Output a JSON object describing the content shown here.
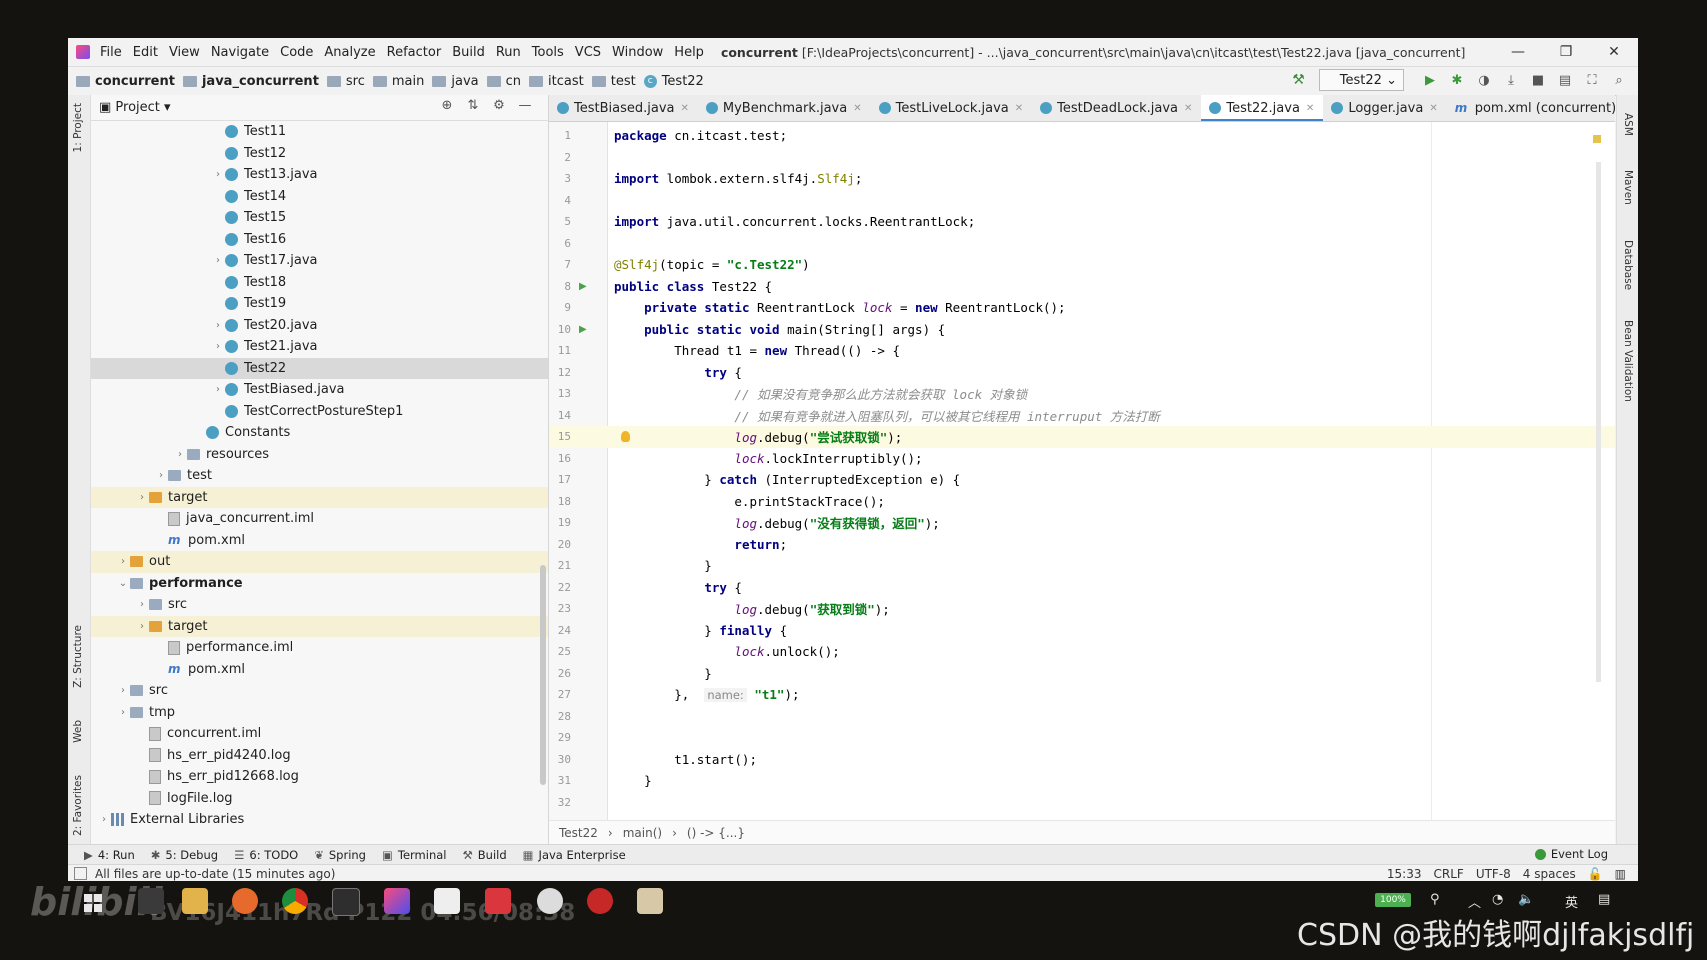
{
  "menu": {
    "items": [
      "File",
      "Edit",
      "View",
      "Navigate",
      "Code",
      "Analyze",
      "Refactor",
      "Build",
      "Run",
      "Tools",
      "VCS",
      "Window",
      "Help"
    ],
    "title_bold": "concurrent",
    "title_rest": "[F:\\IdeaProjects\\concurrent] - ...\\java_concurrent\\src\\main\\java\\cn\\itcast\\test\\Test22.java [java_concurrent]"
  },
  "navbar": {
    "crumbs": [
      "concurrent",
      "java_concurrent",
      "src",
      "main",
      "java",
      "cn",
      "itcast",
      "test",
      "Test22"
    ],
    "run_config": "Test22"
  },
  "project": {
    "title": "Project",
    "rows": [
      {
        "label": "Test11",
        "icon": "class",
        "indent": 6,
        "arrow": ""
      },
      {
        "label": "Test12",
        "icon": "class",
        "indent": 6,
        "arrow": ""
      },
      {
        "label": "Test13.java",
        "icon": "class",
        "indent": 6,
        "arrow": ">"
      },
      {
        "label": "Test14",
        "icon": "class",
        "indent": 6,
        "arrow": ""
      },
      {
        "label": "Test15",
        "icon": "class",
        "indent": 6,
        "arrow": ""
      },
      {
        "label": "Test16",
        "icon": "class",
        "indent": 6,
        "arrow": ""
      },
      {
        "label": "Test17.java",
        "icon": "class",
        "indent": 6,
        "arrow": ">"
      },
      {
        "label": "Test18",
        "icon": "class",
        "indent": 6,
        "arrow": ""
      },
      {
        "label": "Test19",
        "icon": "class",
        "indent": 6,
        "arrow": ""
      },
      {
        "label": "Test20.java",
        "icon": "class",
        "indent": 6,
        "arrow": ">"
      },
      {
        "label": "Test21.java",
        "icon": "class",
        "indent": 6,
        "arrow": ">"
      },
      {
        "label": "Test22",
        "icon": "class",
        "indent": 6,
        "arrow": "",
        "state": "sel"
      },
      {
        "label": "TestBiased.java",
        "icon": "class",
        "indent": 6,
        "arrow": ">"
      },
      {
        "label": "TestCorrectPostureStep1",
        "icon": "class",
        "indent": 6,
        "arrow": ""
      },
      {
        "label": "Constants",
        "icon": "class",
        "indent": 5,
        "arrow": ""
      },
      {
        "label": "resources",
        "icon": "folder",
        "indent": 4,
        "arrow": ">"
      },
      {
        "label": "test",
        "icon": "folder",
        "indent": 3,
        "arrow": ">"
      },
      {
        "label": "target",
        "icon": "folder-o",
        "indent": 2,
        "arrow": ">",
        "state": "hl"
      },
      {
        "label": "java_concurrent.iml",
        "icon": "file",
        "indent": 3,
        "arrow": ""
      },
      {
        "label": "pom.xml",
        "icon": "maven",
        "indent": 3,
        "arrow": ""
      },
      {
        "label": "out",
        "icon": "folder-o",
        "indent": 1,
        "arrow": ">",
        "state": "hl"
      },
      {
        "label": "performance",
        "icon": "folder",
        "indent": 1,
        "arrow": "v",
        "bold": true
      },
      {
        "label": "src",
        "icon": "folder",
        "indent": 2,
        "arrow": ">"
      },
      {
        "label": "target",
        "icon": "folder-o",
        "indent": 2,
        "arrow": ">",
        "state": "hl"
      },
      {
        "label": "performance.iml",
        "icon": "file",
        "indent": 3,
        "arrow": ""
      },
      {
        "label": "pom.xml",
        "icon": "maven",
        "indent": 3,
        "arrow": ""
      },
      {
        "label": "src",
        "icon": "folder",
        "indent": 1,
        "arrow": ">"
      },
      {
        "label": "tmp",
        "icon": "folder",
        "indent": 1,
        "arrow": ">"
      },
      {
        "label": "concurrent.iml",
        "icon": "file",
        "indent": 2,
        "arrow": ""
      },
      {
        "label": "hs_err_pid4240.log",
        "icon": "file",
        "indent": 2,
        "arrow": ""
      },
      {
        "label": "hs_err_pid12668.log",
        "icon": "file",
        "indent": 2,
        "arrow": ""
      },
      {
        "label": "logFile.log",
        "icon": "file",
        "indent": 2,
        "arrow": ""
      },
      {
        "label": "External Libraries",
        "icon": "lib",
        "indent": 0,
        "arrow": ">"
      }
    ]
  },
  "tabs": [
    {
      "label": "TestBiased.java",
      "active": false
    },
    {
      "label": "MyBenchmark.java",
      "active": false
    },
    {
      "label": "TestLiveLock.java",
      "active": false
    },
    {
      "label": "TestDeadLock.java",
      "active": false
    },
    {
      "label": "Test22.java",
      "active": true
    },
    {
      "label": "Logger.java",
      "active": false
    },
    {
      "label": "pom.xml (concurrent)",
      "active": false
    }
  ],
  "code": [
    {
      "n": "1",
      "html": "<span class=\"kw\">package</span> cn.itcast.test;"
    },
    {
      "n": "2",
      "html": ""
    },
    {
      "n": "3",
      "html": "<span class=\"kw\">import</span> lombok.extern.slf4j.<span class=\"ann\">Slf4j</span>;"
    },
    {
      "n": "4",
      "html": ""
    },
    {
      "n": "5",
      "html": "<span class=\"kw\">import</span> java.util.concurrent.locks.ReentrantLock;"
    },
    {
      "n": "6",
      "html": ""
    },
    {
      "n": "7",
      "html": "<span class=\"ann\">@Slf4j</span>(topic = <span class=\"str\">\"c.Test22\"</span>)"
    },
    {
      "n": "8",
      "html": "<span class=\"kw\">public class</span> Test22 {",
      "run": true
    },
    {
      "n": "9",
      "html": "    <span class=\"kw\">private static</span> ReentrantLock <span class=\"fld\">lock</span> = <span class=\"kw\">new</span> ReentrantLock();"
    },
    {
      "n": "10",
      "html": "    <span class=\"kw\">public static void</span> main(String[] args) {",
      "run": true
    },
    {
      "n": "11",
      "html": "        Thread t1 = <span class=\"kw\">new</span> Thread(() -> {"
    },
    {
      "n": "12",
      "html": "            <span class=\"kw\">try</span> {"
    },
    {
      "n": "13",
      "html": "                <span class=\"cmt\">// 如果没有竞争那么此方法就会获取 lock 对象锁</span>"
    },
    {
      "n": "14",
      "html": "                <span class=\"cmt\">// 如果有竞争就进入阻塞队列，可以被其它线程用 interruput 方法打断</span>"
    },
    {
      "n": "15",
      "html": "                <span class=\"fld\">log</span>.debug(<span class=\"str\">\"尝试获取锁\"</span>);",
      "cur": true,
      "bulb": true
    },
    {
      "n": "16",
      "html": "                <span class=\"fld\">lock</span>.lockInterruptibly();"
    },
    {
      "n": "17",
      "html": "            } <span class=\"kw\">catch</span> (InterruptedException e) {"
    },
    {
      "n": "18",
      "html": "                e.printStackTrace();"
    },
    {
      "n": "19",
      "html": "                <span class=\"fld\">log</span>.debug(<span class=\"str\">\"没有获得锁，返回\"</span>);"
    },
    {
      "n": "20",
      "html": "                <span class=\"kw\">return</span>;"
    },
    {
      "n": "21",
      "html": "            }"
    },
    {
      "n": "22",
      "html": "            <span class=\"kw\">try</span> {"
    },
    {
      "n": "23",
      "html": "                <span class=\"fld\">log</span>.debug(<span class=\"str\">\"获取到锁\"</span>);"
    },
    {
      "n": "24",
      "html": "            } <span class=\"kw\">finally</span> {"
    },
    {
      "n": "25",
      "html": "                <span class=\"fld\">lock</span>.unlock();"
    },
    {
      "n": "26",
      "html": "            }"
    },
    {
      "n": "27",
      "html": "        },  <span class=\"hint\">name:</span> <span class=\"str\">\"t1\"</span>);"
    },
    {
      "n": "28",
      "html": ""
    },
    {
      "n": "29",
      "html": ""
    },
    {
      "n": "30",
      "html": "        t1.start();"
    },
    {
      "n": "31",
      "html": "    }"
    },
    {
      "n": "32",
      "html": ""
    }
  ],
  "editor_breadcrumb": [
    "Test22",
    "main()",
    "() -> {...}"
  ],
  "left_stripe": {
    "project": "1: Project",
    "structure": "Z: Structure",
    "web": "Web",
    "favorites": "2: Favorites"
  },
  "right_stripe": {
    "asm": "ASM",
    "maven": "Maven",
    "database": "Database",
    "bean": "Bean Validation"
  },
  "tool_windows": [
    {
      "icon": "▶",
      "label": "4: Run"
    },
    {
      "icon": "✱",
      "label": "5: Debug"
    },
    {
      "icon": "☰",
      "label": "6: TODO"
    },
    {
      "icon": "❦",
      "label": "Spring"
    },
    {
      "icon": "▣",
      "label": "Terminal"
    },
    {
      "icon": "⚒",
      "label": "Build"
    },
    {
      "icon": "▦",
      "label": "Java Enterprise"
    }
  ],
  "event_log": "Event Log",
  "status": {
    "message": "All files are up-to-date (15 minutes ago)",
    "position": "15:33",
    "line_sep": "CRLF",
    "encoding": "UTF-8",
    "indent": "4 spaces"
  },
  "taskbar": {
    "watermark_logo": "bilibili",
    "watermark_text": "BV16J411h7Rd P122 04:56/08:38",
    "battery": "100%",
    "ime": "英",
    "csdn": "CSDN @我的钱啊djlfakjsdlfj"
  }
}
